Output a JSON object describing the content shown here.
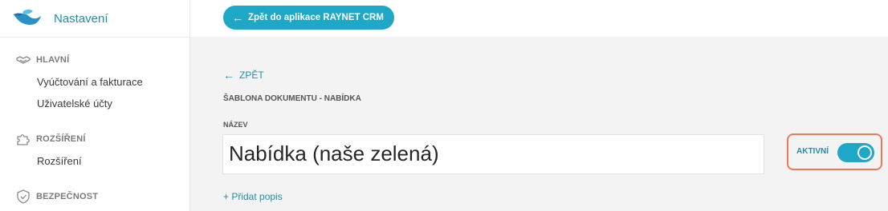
{
  "sidebar": {
    "title": "Nastavení",
    "sections": [
      {
        "label": "HLAVNÍ",
        "icon": "handshake-icon",
        "items": [
          "Vyúčtování a fakturace",
          "Uživatelské účty"
        ]
      },
      {
        "label": "ROZŠÍŘENÍ",
        "icon": "puzzle-icon",
        "items": [
          "Rozšíření"
        ]
      },
      {
        "label": "BEZPEČNOST",
        "icon": "shield-icon",
        "items": []
      }
    ]
  },
  "topbar": {
    "back_to_app": "Zpět do aplikace RAYNET CRM"
  },
  "main": {
    "back_label": "ZPĚT",
    "document_type": "ŠABLONA DOKUMENTU - NABÍDKA",
    "name_label": "NÁZEV",
    "name_value": "Nabídka (naše zelená)",
    "add_description": "+ Přidat popis",
    "active_label": "AKTIVNÍ",
    "active": true
  },
  "colors": {
    "accent": "#1ea7c7",
    "link": "#1f8fa3",
    "highlight": "#ec7a59"
  }
}
